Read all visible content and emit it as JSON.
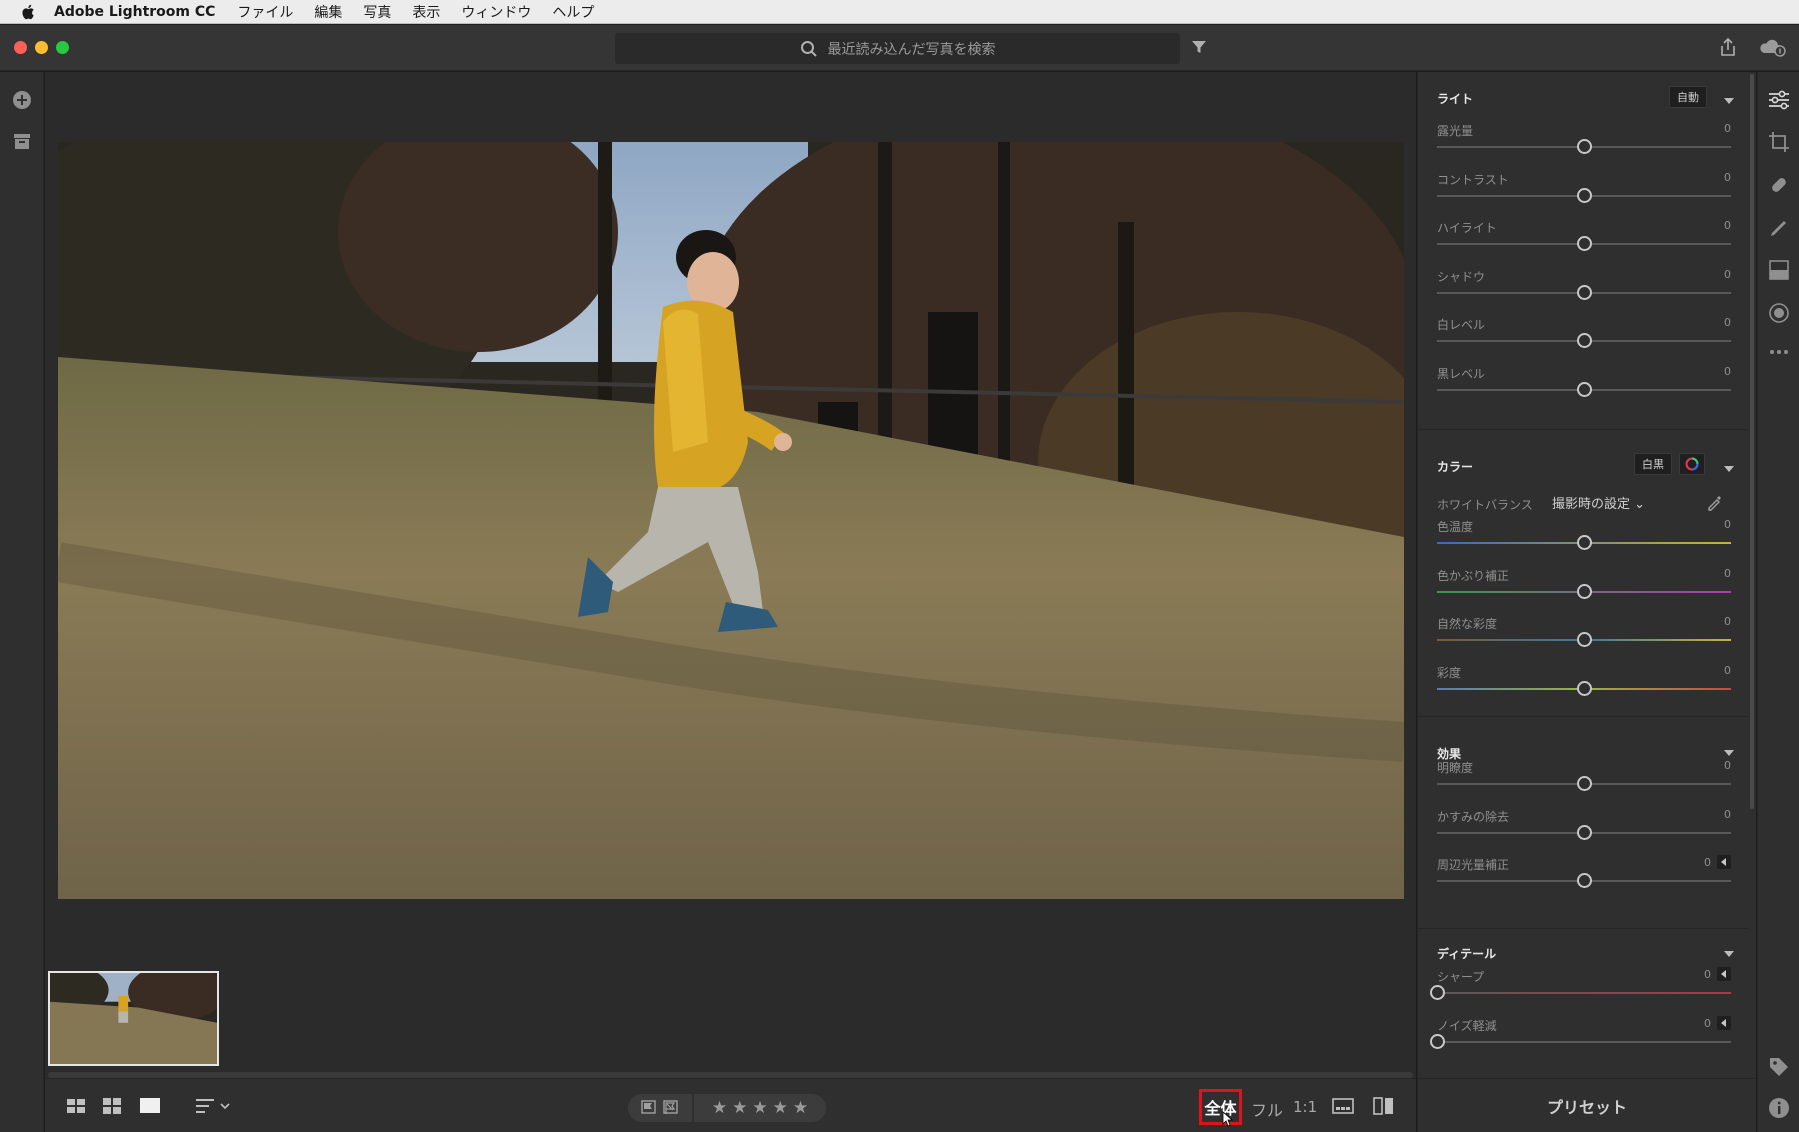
{
  "menubar": {
    "app_name": "Adobe Lightroom CC",
    "items": [
      "ファイル",
      "編集",
      "写真",
      "表示",
      "ウィンドウ",
      "ヘルプ"
    ]
  },
  "titlebar": {
    "search_placeholder": "最近読み込んだ写真を検索"
  },
  "panel": {
    "light": {
      "title": "ライト",
      "auto_label": "自動",
      "sliders": [
        {
          "label": "露光量",
          "value": "0"
        },
        {
          "label": "コントラスト",
          "value": "0"
        },
        {
          "label": "ハイライト",
          "value": "0"
        },
        {
          "label": "シャドウ",
          "value": "0"
        },
        {
          "label": "白レベル",
          "value": "0"
        },
        {
          "label": "黒レベル",
          "value": "0"
        }
      ]
    },
    "color": {
      "title": "カラー",
      "bw_label": "白黒",
      "wb_label": "ホワイトバランス",
      "wb_value": "撮影時の設定",
      "sliders": [
        {
          "label": "色温度",
          "value": "0"
        },
        {
          "label": "色かぶり補正",
          "value": "0"
        },
        {
          "label": "自然な彩度",
          "value": "0"
        },
        {
          "label": "彩度",
          "value": "0"
        }
      ]
    },
    "effects": {
      "title": "効果",
      "sliders": [
        {
          "label": "明瞭度",
          "value": "0"
        },
        {
          "label": "かすみの除去",
          "value": "0"
        },
        {
          "label": "周辺光量補正",
          "value": "0"
        }
      ]
    },
    "detail": {
      "title": "ディテール",
      "sliders": [
        {
          "label": "シャープ",
          "value": "0"
        },
        {
          "label": "ノイズ軽減",
          "value": "0"
        }
      ]
    },
    "preset_label": "プリセット"
  },
  "bottombar": {
    "zoom_fit": "全体",
    "zoom_full": "フル",
    "zoom_1to1": "1:1",
    "stars": [
      "★",
      "★",
      "★",
      "★",
      "★"
    ]
  },
  "colors": {
    "accent_highlight": "#e0121e",
    "panel_bg": "#2f2f2f",
    "canvas_bg": "#2b2b2b"
  }
}
